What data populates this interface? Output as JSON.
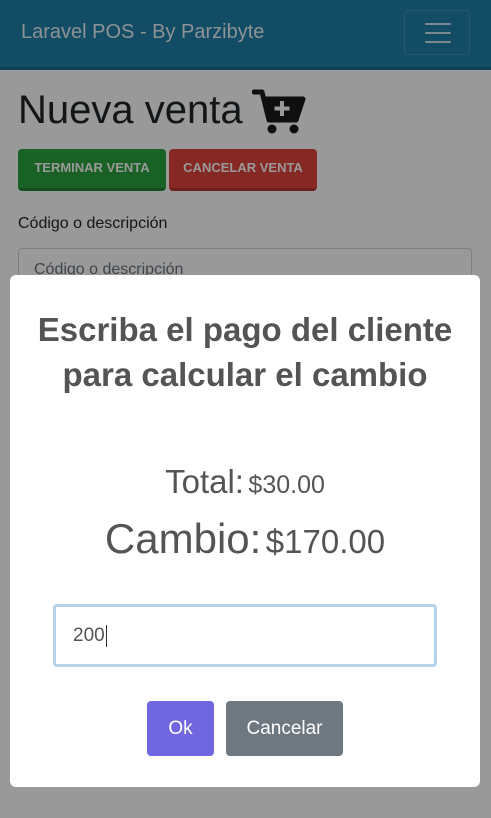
{
  "navbar": {
    "brand": "Laravel POS - By Parzibyte",
    "toggler_icon": "hamburger-icon"
  },
  "page": {
    "title": "Nueva venta",
    "title_icon": "cart-plus-icon",
    "finish_button": "TERMINAR VENTA",
    "cancel_button": "CANCELAR VENTA",
    "code_label": "Código o descripción",
    "code_placeholder": "Código o descripción"
  },
  "modal": {
    "title": "Escriba el pago del cliente para calcular el cambio",
    "total_label": "Total:",
    "total_value": "$30.00",
    "cambio_label": "Cambio:",
    "cambio_value": "$170.00",
    "payment_value": "200",
    "ok_button": "Ok",
    "cancel_button": "Cancelar"
  },
  "colors": {
    "navbar": "#1f7fa8",
    "finish": "#2ca23f",
    "cancel_sale": "#e0453c",
    "ok": "#7066e0",
    "cancel": "#6e7881"
  }
}
